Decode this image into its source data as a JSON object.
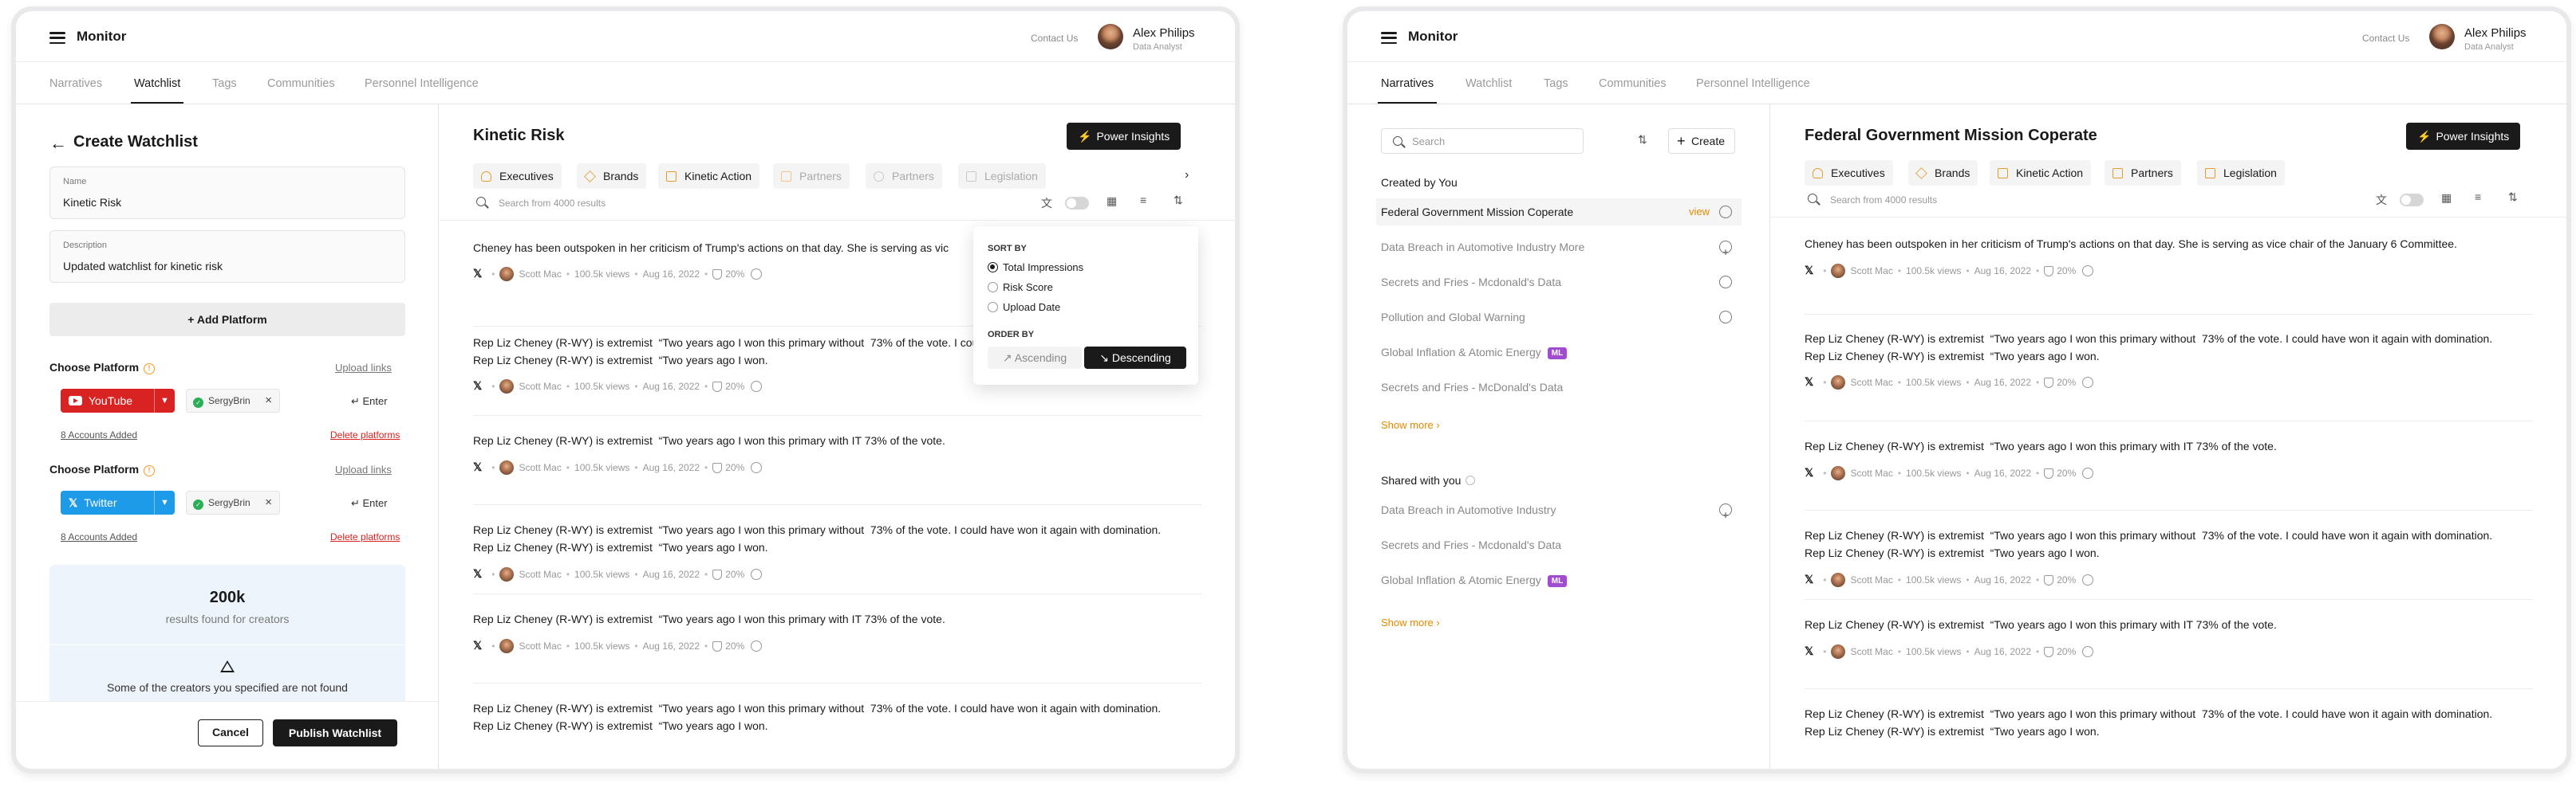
{
  "app": {
    "title": "Monitor"
  },
  "header": {
    "contact": "Contact Us",
    "user_name": "Alex Philips",
    "user_role": "Data Analyst"
  },
  "tabs": [
    "Narratives",
    "Watchlist",
    "Tags",
    "Communities",
    "Personnel Intelligence"
  ],
  "left_screen": {
    "active_tab": "Watchlist",
    "form": {
      "title": "Create Watchlist",
      "name_label": "Name",
      "name_value": "Kinetic Risk",
      "description_label": "Description",
      "description_value": "Updated watchlist for kinetic risk",
      "add_platform": "+ Add Platform",
      "platforms": [
        {
          "choose_label": "Choose Platform",
          "upload_links": "Upload links",
          "platform": "YouTube",
          "chip": "SergyBrin",
          "enter": "Enter",
          "accounts": "8 Accounts Added",
          "delete": "Delete platforms"
        },
        {
          "choose_label": "Choose Platform",
          "upload_links": "Upload links",
          "platform": "Twitter",
          "chip": "SergyBrin",
          "enter": "Enter",
          "accounts": "8 Accounts Added",
          "delete": "Delete platforms"
        }
      ],
      "results_count": "200k",
      "results_label": "results found for creators",
      "warning_text": "Some of the creators you specified are not found",
      "cancel": "Cancel",
      "publish": "Publish Watchlist"
    },
    "main": {
      "title": "Kinetic Risk",
      "power_insights": "Power Insights",
      "categories": [
        "Executives",
        "Brands",
        "Kinetic Action",
        "Partners",
        "Partners",
        "Legislation"
      ],
      "search_placeholder": "Search from 4000 results",
      "sort_menu": {
        "sort_by_label": "SORT BY",
        "options": [
          "Total Impressions",
          "Risk Score",
          "Upload Date"
        ],
        "selected": "Total Impressions",
        "order_by_label": "ORDER BY",
        "ascending": "Ascending",
        "descending": "Descending",
        "selected_order": "Descending"
      },
      "feed": [
        {
          "text": "Cheney has been outspoken in her criticism of Trump's actions on that day. She is serving as vic",
          "author": "Scott Mac",
          "views": "100.5k views",
          "date": "Aug 16, 2022",
          "risk": "20%"
        },
        {
          "text": "Rep Liz Cheney (R-WY) is extremist  “Two years ago I won this primary without  73% of the vote. I could have won it again with domination.\nRep Liz Cheney (R-WY) is extremist  “Two years ago I won.",
          "author": "Scott Mac",
          "views": "100.5k views",
          "date": "Aug 16, 2022",
          "risk": "20%"
        },
        {
          "text": "Rep Liz Cheney (R-WY) is extremist  “Two years ago I won this primary with IT 73% of the vote.",
          "author": "Scott Mac",
          "views": "100.5k views",
          "date": "Aug 16, 2022",
          "risk": "20%"
        },
        {
          "text": "Rep Liz Cheney (R-WY) is extremist  “Two years ago I won this primary without  73% of the vote. I could have won it again with domination.\nRep Liz Cheney (R-WY) is extremist  “Two years ago I won.",
          "author": "Scott Mac",
          "views": "100.5k views",
          "date": "Aug 16, 2022",
          "risk": "20%"
        },
        {
          "text": "Rep Liz Cheney (R-WY) is extremist  “Two years ago I won this primary with IT 73% of the vote.",
          "author": "Scott Mac",
          "views": "100.5k views",
          "date": "Aug 16, 2022",
          "risk": "20%"
        },
        {
          "text": "Rep Liz Cheney (R-WY) is extremist  “Two years ago I won this primary without  73% of the vote. I could have won it again with domination.\nRep Liz Cheney (R-WY) is extremist  “Two years ago I won."
        }
      ]
    }
  },
  "right_screen": {
    "active_tab": "Narratives",
    "sidebar": {
      "search_placeholder": "Search",
      "create": "Create",
      "created_by_you": "Created by You",
      "created_items": [
        {
          "label": "Federal Government Mission Coperate",
          "action": "view"
        },
        {
          "label": "Data Breach in Automotive Industry More"
        },
        {
          "label": "Secrets and Fries - Mcdonald's Data"
        },
        {
          "label": "Pollution and Global Warning"
        },
        {
          "label": "Global Inflation & Atomic Energy",
          "badge": "ML"
        },
        {
          "label": "Secrets and Fries - McDonald's Data"
        }
      ],
      "show_more": "Show more",
      "shared_with_you": "Shared with you",
      "shared_items": [
        {
          "label": "Data Breach in Automotive Industry"
        },
        {
          "label": "Secrets and Fries - Mcdonald's Data"
        },
        {
          "label": "Global Inflation & Atomic Energy",
          "badge": "ML"
        }
      ],
      "show_more_2": "Show more"
    },
    "main": {
      "title": "Federal Government Mission Coperate",
      "power_insights": "Power Insights",
      "categories": [
        "Executives",
        "Brands",
        "Kinetic Action",
        "Partners",
        "Legislation"
      ],
      "search_placeholder": "Search from 4000 results",
      "feed": [
        {
          "text": "Cheney has been outspoken in her criticism of Trump's actions on that day. She is serving as vice chair of the January 6 Committee.",
          "author": "Scott Mac",
          "views": "100.5k views",
          "date": "Aug 16, 2022",
          "risk": "20%"
        },
        {
          "text": "Rep Liz Cheney (R-WY) is extremist  “Two years ago I won this primary without  73% of the vote. I could have won it again with domination.\nRep Liz Cheney (R-WY) is extremist  “Two years ago I won.",
          "author": "Scott Mac",
          "views": "100.5k views",
          "date": "Aug 16, 2022",
          "risk": "20%"
        },
        {
          "text": "Rep Liz Cheney (R-WY) is extremist  “Two years ago I won this primary with IT 73% of the vote.",
          "author": "Scott Mac",
          "views": "100.5k views",
          "date": "Aug 16, 2022",
          "risk": "20%"
        },
        {
          "text": "Rep Liz Cheney (R-WY) is extremist  “Two years ago I won this primary without  73% of the vote. I could have won it again with domination.\nRep Liz Cheney (R-WY) is extremist  “Two years ago I won.",
          "author": "Scott Mac",
          "views": "100.5k views",
          "date": "Aug 16, 2022",
          "risk": "20%"
        },
        {
          "text": "Rep Liz Cheney (R-WY) is extremist  “Two years ago I won this primary with IT 73% of the vote.",
          "author": "Scott Mac",
          "views": "100.5k views",
          "date": "Aug 16, 2022",
          "risk": "20%"
        },
        {
          "text": "Rep Liz Cheney (R-WY) is extremist  “Two years ago I won this primary without  73% of the vote. I could have won it again with domination.\nRep Liz Cheney (R-WY) is extremist  “Two years ago I won."
        }
      ]
    }
  },
  "colors": {
    "accent": "#1a1a1a",
    "youtube": "#d92222",
    "twitter": "#1e9be8",
    "link_orange": "#e08a00",
    "ml_badge": "#a04bd0",
    "bolt": "#f5c518"
  }
}
